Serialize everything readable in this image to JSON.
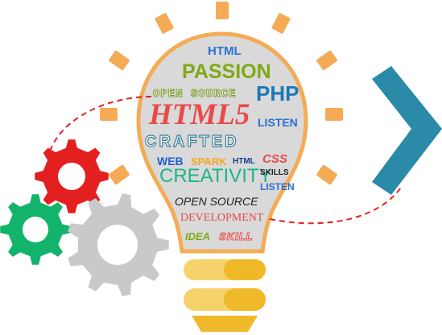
{
  "words": {
    "html_top": "HTML",
    "passion": "PASSION",
    "open_source_1": "OPEN SOURCE",
    "php": "PHP",
    "html5": "HTML5",
    "listen_1": "LISTEN",
    "crafted": "CRAFTED",
    "web": "WEB",
    "spark": "SPARK",
    "html_mid": "HTML",
    "css": "CSS",
    "creativity": "CREATIVITY",
    "skills": "SKILLS",
    "listen_2": "LISTEN",
    "open_source_2": "OPEN SOURCE",
    "development": "DEVELOPMENT",
    "idea": "IDEA",
    "skill": "SKILL"
  },
  "colors": {
    "bulb_fill": "#d9d9d9",
    "bulb_outline": "#f5ab55",
    "rays": "#f5ab55",
    "base": "#f4c842",
    "gear_red": "#e41f1f",
    "gear_green": "#12b36a",
    "gear_gray": "#c9c9c9",
    "chevron": "#2b8aa8",
    "dashed_line": "#e41f1f"
  }
}
